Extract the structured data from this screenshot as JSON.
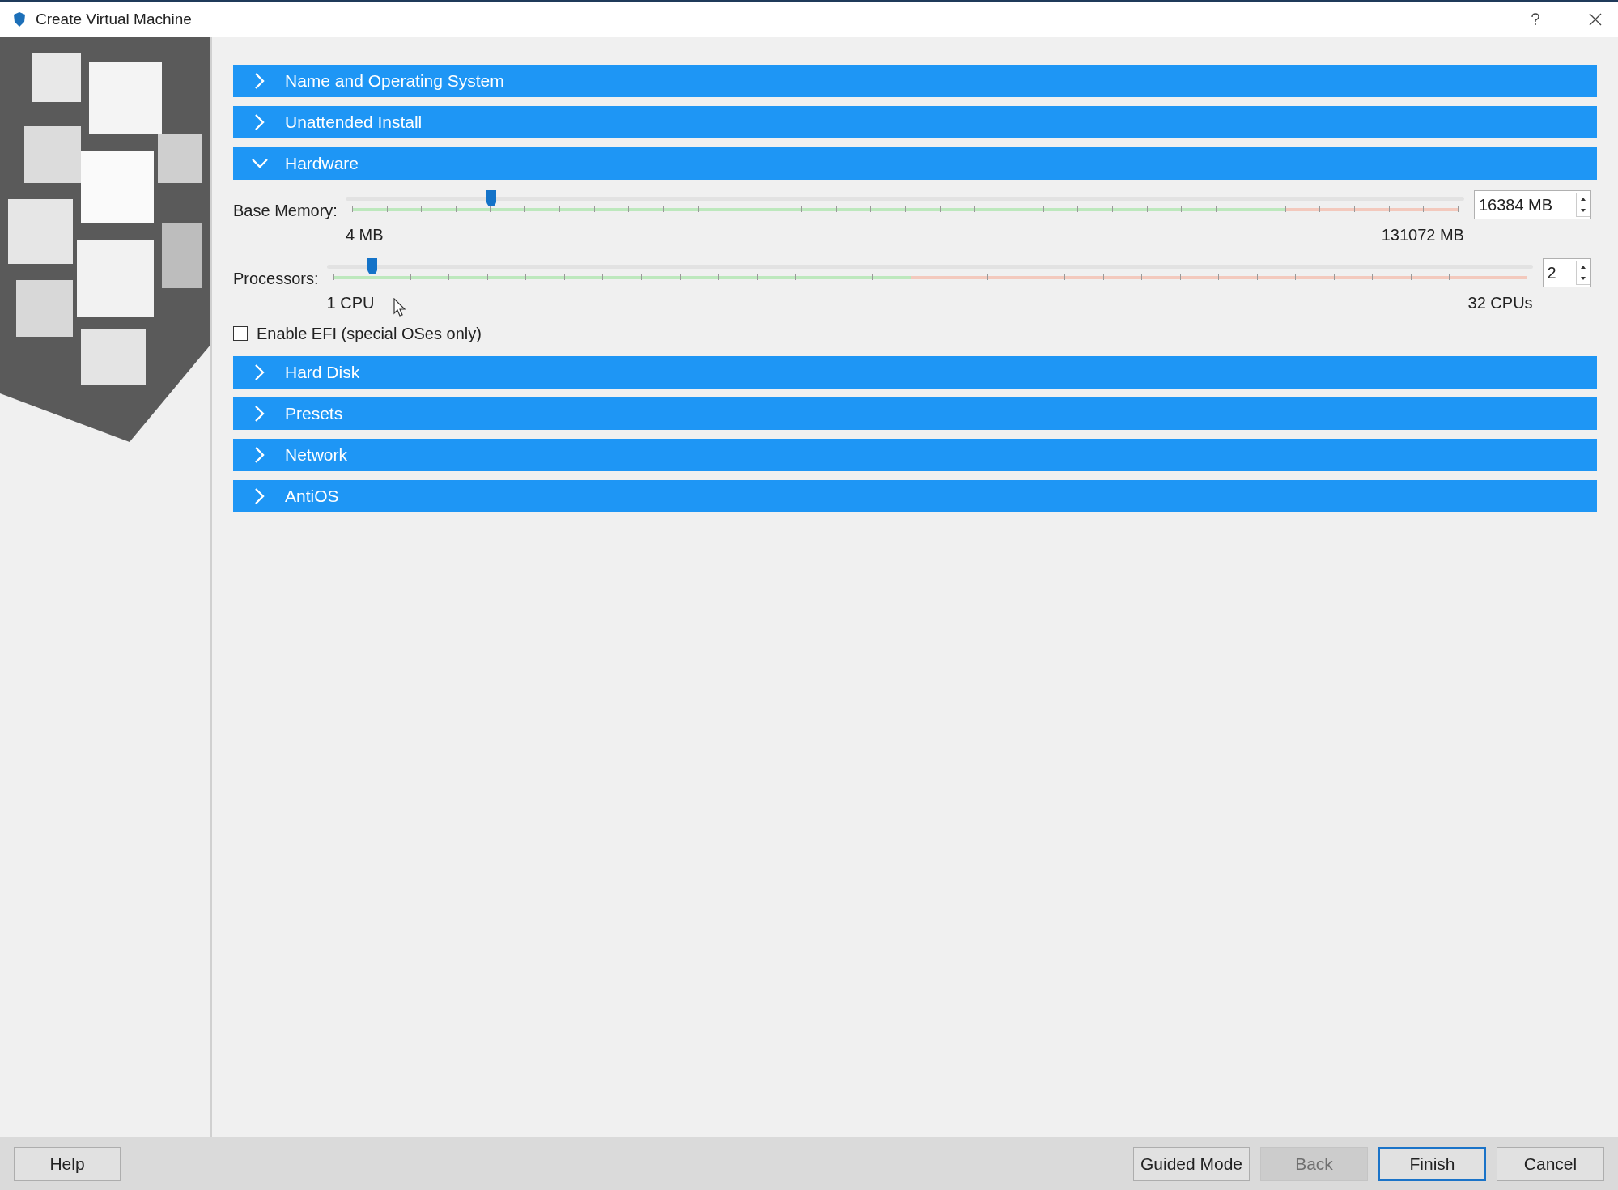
{
  "window": {
    "title": "Create Virtual Machine"
  },
  "sections": [
    {
      "title": "Name and Operating System",
      "expanded": false
    },
    {
      "title": "Unattended Install",
      "expanded": false
    },
    {
      "title": "Hardware",
      "expanded": true,
      "sliders": [
        {
          "label": "Base Memory:",
          "level": 0.126,
          "min_label": "4 MB",
          "max_label": "131072 MB",
          "value": "16384 MB"
        },
        {
          "label": "Processors:",
          "level": 0.033,
          "min_label": "1 CPU",
          "max_label": "32 CPUs",
          "value": "2"
        }
      ],
      "checkbox": {
        "label": "Enable EFI (special OSes only)",
        "checked": false
      }
    },
    {
      "title": "Hard Disk",
      "expanded": false
    },
    {
      "title": "Presets",
      "expanded": false
    },
    {
      "title": "Network",
      "expanded": false
    },
    {
      "title": "AntiOS",
      "expanded": false
    }
  ],
  "buttons": [
    {
      "label": "Help",
      "disabled": false,
      "default": false
    },
    {
      "label": "Guided Mode",
      "disabled": false,
      "default": false
    },
    {
      "label": "Back",
      "disabled": true,
      "default": false
    },
    {
      "label": "Finish",
      "disabled": false,
      "default": true
    },
    {
      "label": "Cancel",
      "disabled": false,
      "default": false
    }
  ]
}
